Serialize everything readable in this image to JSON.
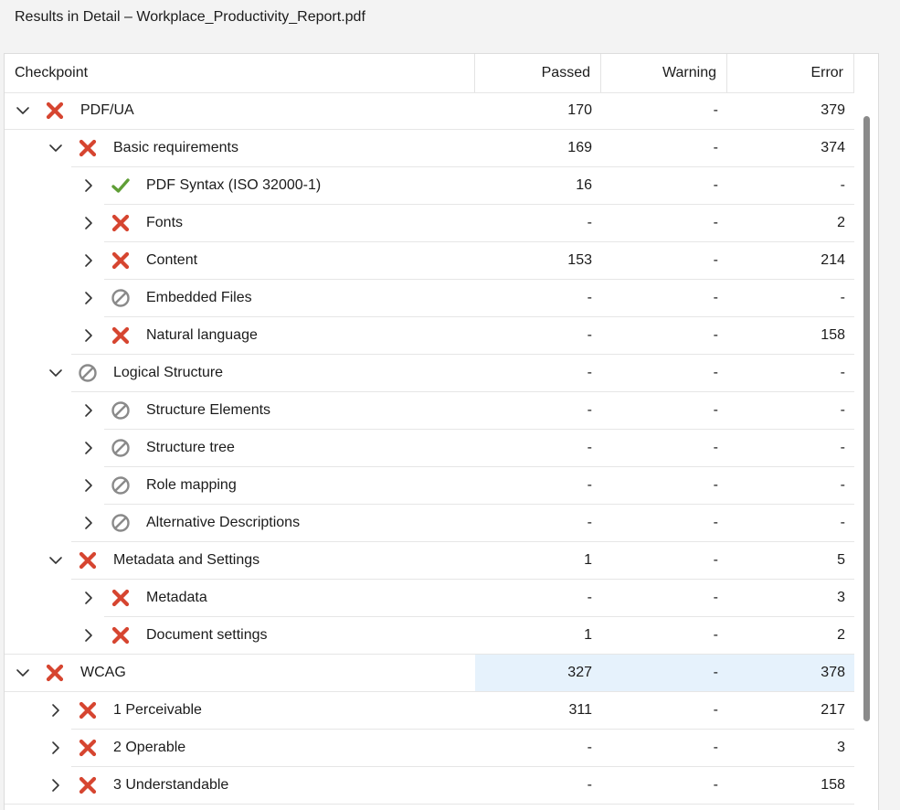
{
  "window": {
    "title": "Results in Detail – Workplace_Productivity_Report.pdf"
  },
  "columns": {
    "checkpoint": "Checkpoint",
    "passed": "Passed",
    "warning": "Warning",
    "error": "Error"
  },
  "colors": {
    "error": "#d64530",
    "pass": "#5f9e36",
    "na": "#8a8a8a",
    "selected": "#e6f2fc"
  },
  "rows": [
    {
      "label": "PDF/UA",
      "level": 0,
      "expanded": true,
      "status": "error",
      "passed": "170",
      "warning": "-",
      "error": "379"
    },
    {
      "label": "Basic requirements",
      "level": 1,
      "expanded": true,
      "status": "error",
      "passed": "169",
      "warning": "-",
      "error": "374"
    },
    {
      "label": "PDF Syntax (ISO 32000-1)",
      "level": 2,
      "expanded": false,
      "status": "pass",
      "passed": "16",
      "warning": "-",
      "error": "-"
    },
    {
      "label": "Fonts",
      "level": 2,
      "expanded": false,
      "status": "error",
      "passed": "-",
      "warning": "-",
      "error": "2"
    },
    {
      "label": "Content",
      "level": 2,
      "expanded": false,
      "status": "error",
      "passed": "153",
      "warning": "-",
      "error": "214"
    },
    {
      "label": "Embedded Files",
      "level": 2,
      "expanded": false,
      "status": "na",
      "passed": "-",
      "warning": "-",
      "error": "-"
    },
    {
      "label": "Natural language",
      "level": 2,
      "expanded": false,
      "status": "error",
      "passed": "-",
      "warning": "-",
      "error": "158"
    },
    {
      "label": "Logical Structure",
      "level": 1,
      "expanded": true,
      "status": "na",
      "passed": "-",
      "warning": "-",
      "error": "-"
    },
    {
      "label": "Structure Elements",
      "level": 2,
      "expanded": false,
      "status": "na",
      "passed": "-",
      "warning": "-",
      "error": "-"
    },
    {
      "label": "Structure tree",
      "level": 2,
      "expanded": false,
      "status": "na",
      "passed": "-",
      "warning": "-",
      "error": "-"
    },
    {
      "label": "Role mapping",
      "level": 2,
      "expanded": false,
      "status": "na",
      "passed": "-",
      "warning": "-",
      "error": "-"
    },
    {
      "label": "Alternative Descriptions",
      "level": 2,
      "expanded": false,
      "status": "na",
      "passed": "-",
      "warning": "-",
      "error": "-"
    },
    {
      "label": "Metadata and Settings",
      "level": 1,
      "expanded": true,
      "status": "error",
      "passed": "1",
      "warning": "-",
      "error": "5"
    },
    {
      "label": "Metadata",
      "level": 2,
      "expanded": false,
      "status": "error",
      "passed": "-",
      "warning": "-",
      "error": "3"
    },
    {
      "label": "Document settings",
      "level": 2,
      "expanded": false,
      "status": "error",
      "passed": "1",
      "warning": "-",
      "error": "2"
    },
    {
      "label": "WCAG",
      "level": 0,
      "expanded": true,
      "status": "error",
      "passed": "327",
      "warning": "-",
      "error": "378",
      "selected": true
    },
    {
      "label": "1 Perceivable",
      "level": 1,
      "expanded": false,
      "status": "error",
      "passed": "311",
      "warning": "-",
      "error": "217"
    },
    {
      "label": "2 Operable",
      "level": 1,
      "expanded": false,
      "status": "error",
      "passed": "-",
      "warning": "-",
      "error": "3"
    },
    {
      "label": "3 Understandable",
      "level": 1,
      "expanded": false,
      "status": "error",
      "passed": "-",
      "warning": "-",
      "error": "158"
    }
  ]
}
